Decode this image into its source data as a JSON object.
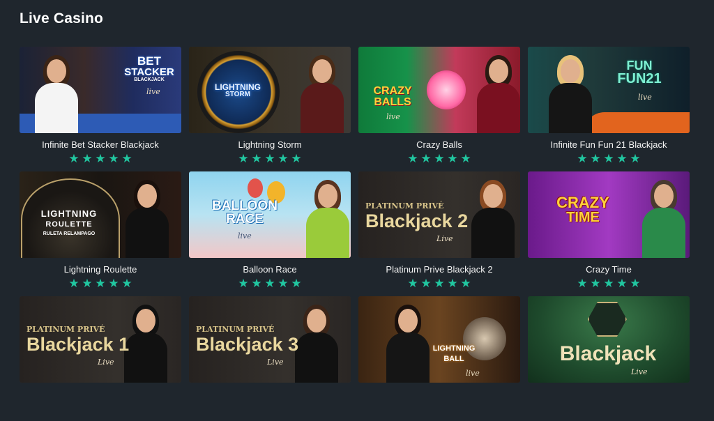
{
  "page": {
    "title": "Live Casino"
  },
  "colors": {
    "background": "#1f262d",
    "star": "#21c6a0",
    "title_text": "#ffffff"
  },
  "games": [
    {
      "title": "Infinite Bet Stacker Blackjack",
      "rating": 5,
      "logo": [
        "BET",
        "STACKER",
        "BLACKJACK"
      ],
      "live": "live"
    },
    {
      "title": "Lightning Storm",
      "rating": 5,
      "logo": [
        "LIGHTNING",
        "STORM"
      ],
      "live": ""
    },
    {
      "title": "Crazy Balls",
      "rating": 5,
      "logo": [
        "CRAZY",
        "BALLS"
      ],
      "live": "live"
    },
    {
      "title": "Infinite Fun Fun 21 Blackjack",
      "rating": 5,
      "logo": [
        "FUN",
        "FUN21"
      ],
      "live": "live"
    },
    {
      "title": "Lightning Roulette",
      "rating": 5,
      "logo": [
        "LIGHTNING",
        "ROULETTE",
        "RULETA RELAMPAGO"
      ],
      "live": ""
    },
    {
      "title": "Balloon Race",
      "rating": 5,
      "logo": [
        "BALLOON",
        "RACE"
      ],
      "live": "live"
    },
    {
      "title": "Platinum Prive Blackjack 2",
      "rating": 5,
      "logo": [
        "PLATINUM PRIVÉ",
        "Blackjack 2"
      ],
      "live": "Live"
    },
    {
      "title": "Crazy Time",
      "rating": 5,
      "logo": [
        "CRAZY",
        "TIME"
      ],
      "live": ""
    },
    {
      "title": "",
      "rating": 0,
      "logo": [
        "PLATINUM PRIVÉ",
        "Blackjack 1"
      ],
      "live": "Live"
    },
    {
      "title": "",
      "rating": 0,
      "logo": [
        "PLATINUM PRIVÉ",
        "Blackjack 3"
      ],
      "live": "Live"
    },
    {
      "title": "",
      "rating": 0,
      "logo": [
        "LIGHTNING",
        "BALL"
      ],
      "live": "live"
    },
    {
      "title": "",
      "rating": 0,
      "logo": [
        "Blackjack"
      ],
      "live": "Live"
    }
  ]
}
